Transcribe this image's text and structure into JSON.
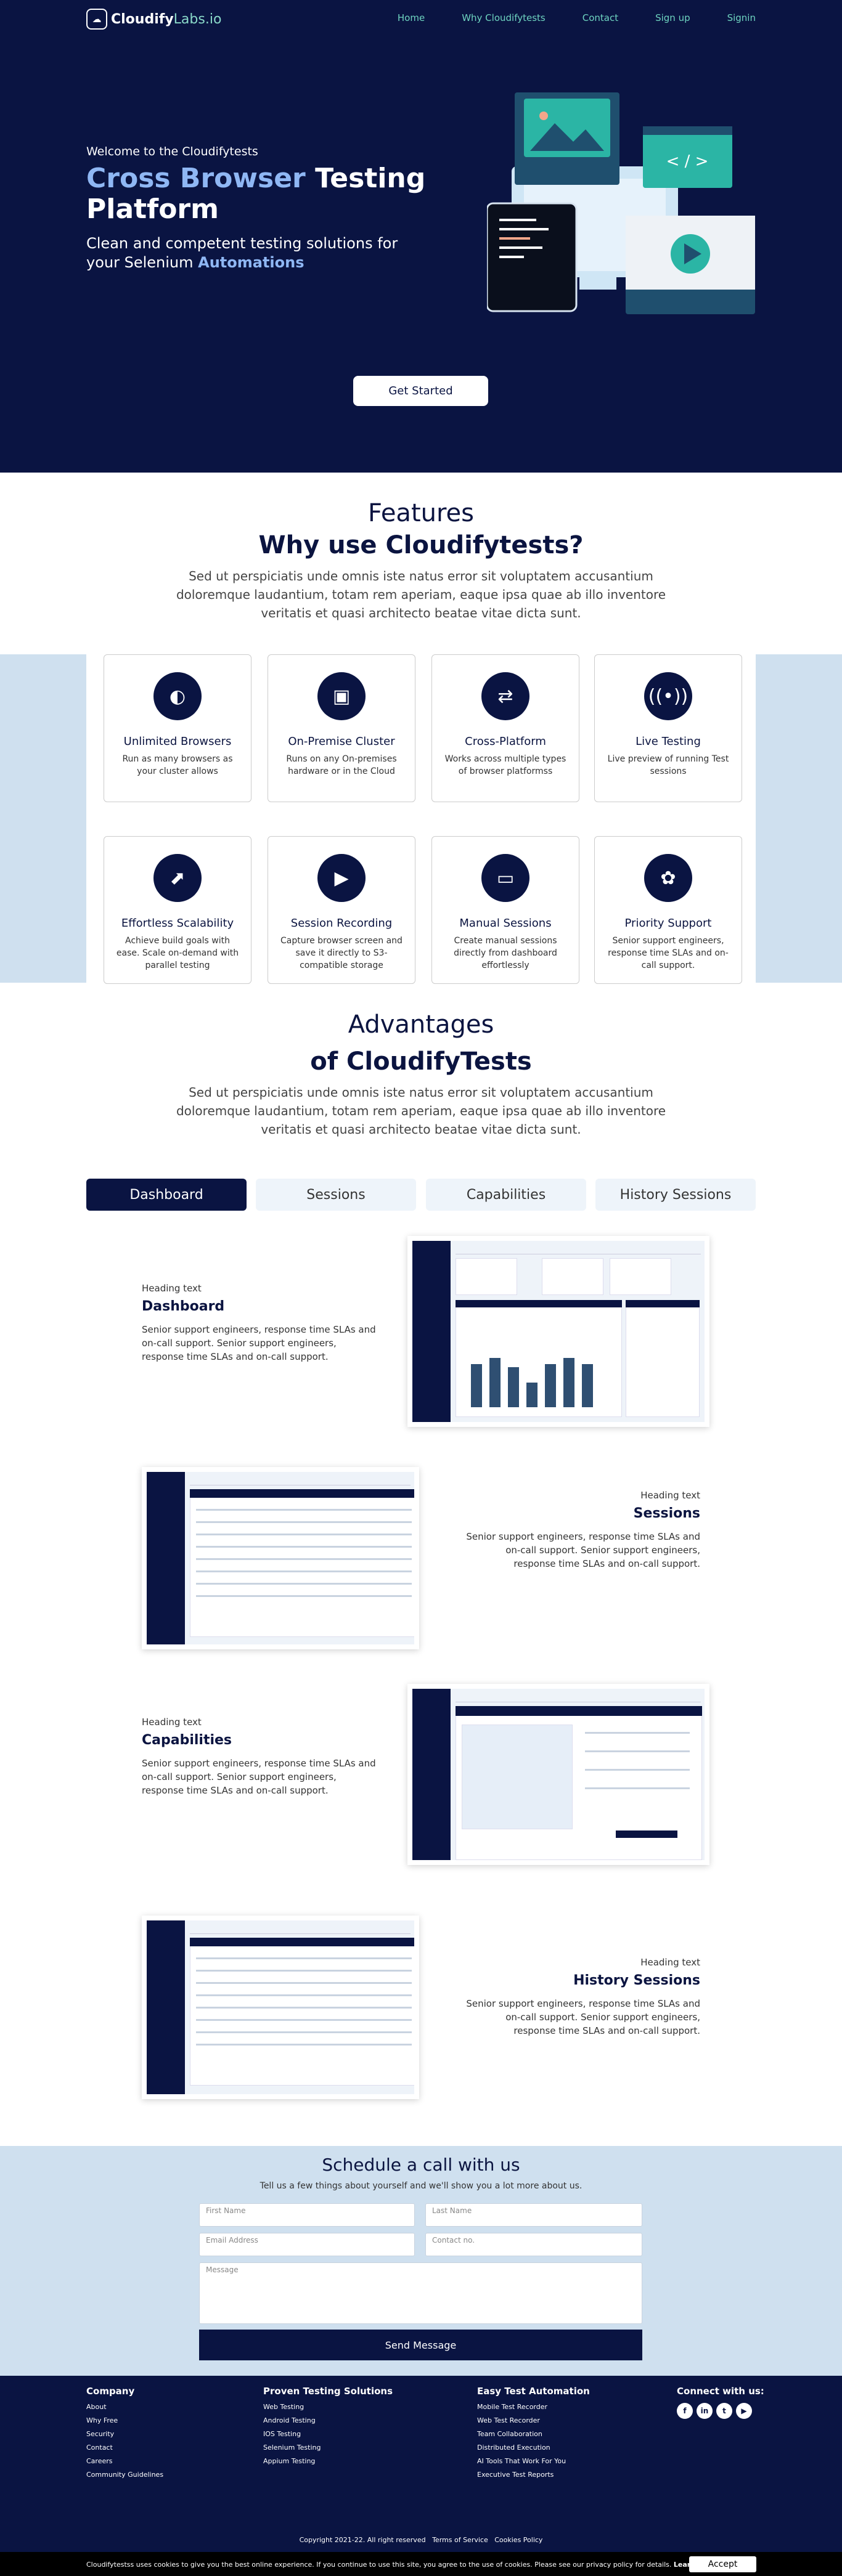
{
  "nav": {
    "brand_a": "Cloudify",
    "brand_b": "Labs.io",
    "links": [
      "Home",
      "Why Cloudifytests",
      "Contact",
      "Sign up",
      "Signin"
    ]
  },
  "hero": {
    "welcome": "Welcome to the Cloudifytests",
    "title_blue": "Cross Browser",
    "title_rest": " Testing Platform",
    "subtitle": "Clean and competent testing solutions for your Selenium ",
    "subtitle_bold": "Automations",
    "cta": "Get Started",
    "code_icon": "< / >"
  },
  "features": {
    "light": "Features",
    "bold": "Why use Cloudifytests?",
    "para": "Sed ut perspiciatis unde omnis iste natus error sit voluptatem accusantium doloremque laudantium, totam rem aperiam, eaque ipsa quae ab illo inventore veritatis et quasi architecto beatae vitae dicta sunt.",
    "cards": [
      {
        "icon": "globe-icon",
        "glyph": "◐",
        "title": "Unlimited Browsers",
        "desc": "Run as many browsers as your cluster allows"
      },
      {
        "icon": "server-icon",
        "glyph": "▣",
        "title": "On-Premise Cluster",
        "desc": "Runs on any On-premises hardware or in the Cloud"
      },
      {
        "icon": "swap-icon",
        "glyph": "⇄",
        "title": "Cross-Platform",
        "desc": "Works across multiple types of browser platformss"
      },
      {
        "icon": "broadcast-icon",
        "glyph": "((•))",
        "title": "Live Testing",
        "desc": "Live preview of running Test sessions"
      },
      {
        "icon": "external-link-icon",
        "glyph": "⬈",
        "title": "Effortless Scalability",
        "desc": "Achieve build goals with ease. Scale on-demand with parallel testing"
      },
      {
        "icon": "video-icon",
        "glyph": "▶",
        "title": "Session Recording",
        "desc": "Capture browser screen and save it directly to S3-compatible storage"
      },
      {
        "icon": "monitor-icon",
        "glyph": "▭",
        "title": "Manual Sessions",
        "desc": "Create manual sessions directly from dashboard effortlessly"
      },
      {
        "icon": "badge-icon",
        "glyph": "✿",
        "title": "Priority Support",
        "desc": "Senior support engineers, response time SLAs and on-call support."
      }
    ]
  },
  "advantages": {
    "light": "Advantages",
    "bold": "of CloudifyTests",
    "para": "Sed ut perspiciatis unde omnis iste natus error sit voluptatem accusantium doloremque laudantium, totam rem aperiam, eaque ipsa quae ab illo inventore veritatis et quasi architecto beatae vitae dicta sunt.",
    "tabs": [
      "Dashboard",
      "Sessions",
      "Capabilities",
      "History Sessions"
    ],
    "rows": [
      {
        "small": "Heading text",
        "big": "Dashboard",
        "desc": "Senior support engineers, response time SLAs and on-call support. Senior support engineers, response time SLAs and on-call support."
      },
      {
        "small": "Heading text",
        "big": "Sessions",
        "desc": "Senior support engineers, response time SLAs and on-call support. Senior support engineers, response time SLAs and on-call support."
      },
      {
        "small": "Heading text",
        "big": "Capabilities",
        "desc": "Senior support engineers, response time SLAs and on-call support. Senior support engineers, response time SLAs and on-call support."
      },
      {
        "small": "Heading text",
        "big": "History Sessions",
        "desc": "Senior support engineers, response time SLAs and on-call support. Senior support engineers, response time SLAs and on-call support."
      }
    ]
  },
  "schedule": {
    "title": "Schedule a call with us",
    "sub": "Tell us a few things about yourself and we'll show you a lot more about us.",
    "first": "First Name",
    "last": "Last Name",
    "email": "Email Address",
    "contact": "Contact no.",
    "message": "Message",
    "send": "Send Message"
  },
  "footer": {
    "company": {
      "h": "Company",
      "items": [
        "About",
        "Why Free",
        "Security",
        "Contact",
        "Careers",
        "Community Guidelines"
      ]
    },
    "proven": {
      "h": "Proven Testing Solutions",
      "items": [
        "Web Testing",
        "Android Testing",
        "IOS Testing",
        "Selenium Testing",
        "Appium Testing"
      ]
    },
    "easy": {
      "h": "Easy Test Automation",
      "items": [
        "Mobile Test Recorder",
        "Web Test Recorder",
        "Team Collaboration",
        "Distributed Execution",
        "AI Tools That Work For You",
        "Executive Test Reports"
      ]
    },
    "connect": "Connect with us:",
    "social": [
      "f",
      "in",
      "t",
      "▶"
    ],
    "copyright": "Copyright 2021-22. All right reserved",
    "terms": "Terms of Service",
    "cookies": "Cookies Policy",
    "cookie_text": "Cloudifytestss uses cookies to give you the best online experience. If you continue to use this site, you agree to the use of cookies. Please see our privacy policy for details.",
    "learn": "Learn more",
    "accept": "Accept"
  },
  "colors": {
    "navy": "#0a1442",
    "teal": "#6ed4c0",
    "light_blue": "#8fb7f4",
    "band": "#cfe0ef"
  }
}
